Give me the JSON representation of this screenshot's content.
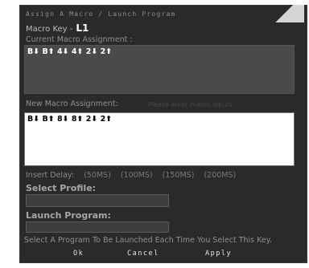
{
  "dialog": {
    "title": "Assign A Macro / Launch Program",
    "macro_key_label": "Macro Key -",
    "macro_key_value": "L1"
  },
  "current": {
    "label": "Current Macro Assignment :",
    "sequence": "B⬇ B⬆ 4⬇ 4⬆ 2⬇ 2⬆"
  },
  "new": {
    "label": "New Macro Assignment:",
    "hint": "Please enter macro inputs",
    "sequence": "B⬇ B⬆ 8⬇ 8⬆ 2⬇ 2⬆"
  },
  "delay": {
    "label": "Insert Delay:",
    "options": [
      "(50MS)",
      "(100MS)",
      "(150MS)",
      "(200MS)"
    ]
  },
  "profile": {
    "label": "Select Profile:",
    "value": ""
  },
  "program": {
    "label": "Launch Program:",
    "value": ""
  },
  "footer": {
    "note": "Select A Program To Be Launched Each Time You Select This Key."
  },
  "buttons": {
    "ok": "Ok",
    "cancel": "Cancel",
    "apply": "Apply"
  }
}
